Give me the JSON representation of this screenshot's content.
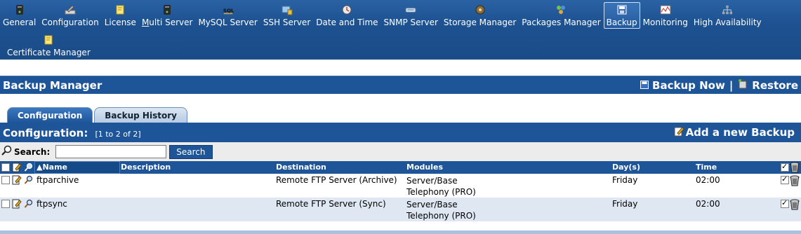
{
  "nav": {
    "items": [
      {
        "key": "general",
        "label": "General",
        "icon": "server-icon"
      },
      {
        "key": "configuration",
        "label": "Configuration",
        "icon": "wrench-icon"
      },
      {
        "key": "license",
        "label": "License",
        "icon": "certificate-icon"
      },
      {
        "key": "multi-server",
        "label": "Multi Server",
        "icon": "server-icon",
        "underline": "M"
      },
      {
        "key": "mysql-server",
        "label": "MySQL Server",
        "icon": "sql-icon"
      },
      {
        "key": "ssh-server",
        "label": "SSH Server",
        "icon": "ssh-icon"
      },
      {
        "key": "date-time",
        "label": "Date and Time",
        "icon": "clock-icon"
      },
      {
        "key": "snmp-server",
        "label": "SNMP Server",
        "icon": "snmp-icon"
      },
      {
        "key": "storage-manager",
        "label": "Storage Manager",
        "icon": "disk-icon"
      },
      {
        "key": "packages-manager",
        "label": "Packages Manager",
        "icon": "packages-icon"
      },
      {
        "key": "backup",
        "label": "Backup",
        "icon": "floppy-icon",
        "active": true
      },
      {
        "key": "monitoring",
        "label": "Monitoring",
        "icon": "monitor-chart-icon"
      },
      {
        "key": "high-availability",
        "label": "High Availability",
        "icon": "network-icon"
      }
    ],
    "row2": [
      {
        "key": "certificate-manager",
        "label": "Certificate Manager",
        "icon": "certificate-icon"
      }
    ]
  },
  "header": {
    "title": "Backup Manager",
    "backup_now": "Backup Now",
    "separator": "|",
    "restore": "Restore"
  },
  "tabs": [
    {
      "label": "Configuration",
      "active": true
    },
    {
      "label": "Backup History",
      "active": false
    }
  ],
  "config_bar": {
    "title": "Configuration:",
    "range": "[1 to 2 of 2]",
    "add_label": "Add a new Backup"
  },
  "search": {
    "label": "Search:",
    "value": "",
    "button": "Search"
  },
  "table": {
    "columns": [
      "▲Name",
      "Description",
      "Destination",
      "Modules",
      "Day(s)",
      "Time"
    ],
    "rows": [
      {
        "name": "ftparchive",
        "description": "",
        "destination": "Remote FTP Server (Archive)",
        "modules": [
          "Server/Base",
          "Telephony (PRO)"
        ],
        "days": "Friday",
        "time": "02:00",
        "enabled": true
      },
      {
        "name": "ftpsync",
        "description": "",
        "destination": "Remote FTP Server (Sync)",
        "modules": [
          "Server/Base",
          "Telephony (PRO)"
        ],
        "days": "Friday",
        "time": "02:00",
        "enabled": true
      }
    ]
  },
  "colors": {
    "bar_blue": "#1e5598",
    "row_alt": "#dfe7f2",
    "header_text": "#ffffff"
  }
}
